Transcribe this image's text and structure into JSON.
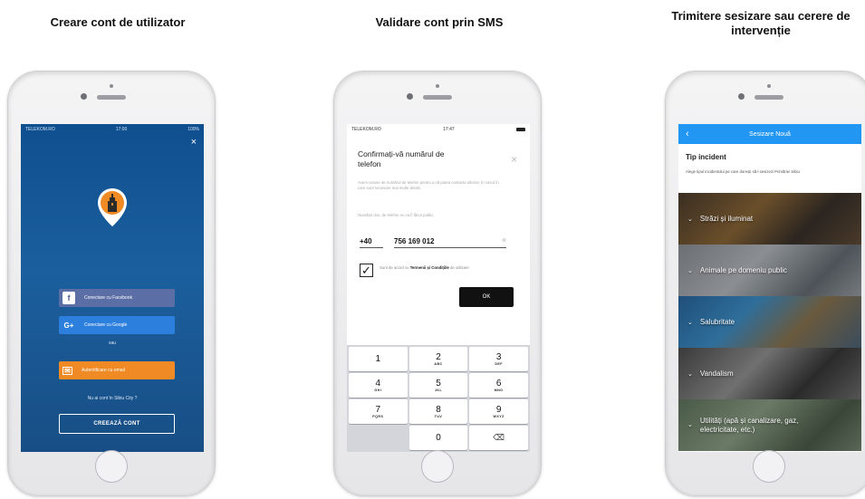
{
  "captions": {
    "left": "Creare cont de utilizator",
    "middle": "Validare cont prin SMS",
    "right": "Trimitere sesizare sau cerere de intervenție"
  },
  "screen1": {
    "status": {
      "carrier": "TELEKOM.RO",
      "time": "17:00",
      "battery": "100%"
    },
    "close": "×",
    "buttons": {
      "facebook": "Conectare cu Facebook",
      "google": "Conectare cu Google",
      "email": "Autentificare cu email"
    },
    "icons": {
      "facebook": "f",
      "google": "G+",
      "email": "✉"
    },
    "or": "sau",
    "no_account": "Nu ai cont în Sibiu City ?",
    "create_account": "CREEAZĂ CONT"
  },
  "screen2": {
    "status": {
      "carrier": "TELEKOM.RO",
      "time": "17:47"
    },
    "title": "Confirmați-vă numărul de telefon",
    "close": "×",
    "info": "Avem nevoie de numărul de telefon pentru a vă putea contacta ulterior, în cazul în care sunt necesare mai multe detalii.",
    "privacy": "Numărul dvs. de telefon nu va fi făcut public.",
    "prefix": "+40",
    "phone": "756 169 012",
    "clear": "⊗",
    "terms_prefix": "Sunt de acord cu ",
    "terms_link": "Termenii și Condițiile",
    "terms_suffix": " de utilizare",
    "checked_mark": "✓",
    "ok": "OK",
    "keypad": [
      {
        "d": "1",
        "l": ""
      },
      {
        "d": "2",
        "l": "ABC"
      },
      {
        "d": "3",
        "l": "DEF"
      },
      {
        "d": "4",
        "l": "GHI"
      },
      {
        "d": "5",
        "l": "JKL"
      },
      {
        "d": "6",
        "l": "MNO"
      },
      {
        "d": "7",
        "l": "PQRS"
      },
      {
        "d": "8",
        "l": "TUV"
      },
      {
        "d": "9",
        "l": "WXYZ"
      },
      {
        "d": "",
        "l": ""
      },
      {
        "d": "0",
        "l": ""
      },
      {
        "d": "⌫",
        "l": ""
      }
    ]
  },
  "screen3": {
    "nav_title": "Sesizare Nouă",
    "back": "‹",
    "section_title": "Tip incident",
    "section_desc": "Alege tipul incidentului pe care dorești să-l sesizezi Primăriei Sibiu",
    "chevron": "⌄",
    "categories": [
      "Străzi și iluminat",
      "Animale pe domeniu public",
      "Salubritate",
      "Vandalism",
      "Utilități (apă și canalizare, gaz, electricitate, etc.)"
    ]
  },
  "colors": {
    "brand_blue": "#1b5f9e",
    "facebook": "#5b6fa6",
    "google": "#2d7fde",
    "email": "#f08a24",
    "nav_blue": "#2196f3"
  }
}
